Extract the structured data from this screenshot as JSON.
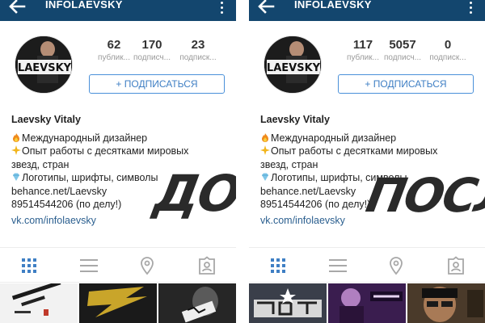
{
  "colors": {
    "header_bg": "#13466e",
    "accent": "#3f7fc4",
    "link": "#2b5f8f"
  },
  "panels": [
    {
      "header": {
        "back_icon": "arrow-left-icon",
        "title": "INFOLAEVSKY",
        "more_icon": "more-vertical-icon"
      },
      "avatar": {
        "logo_text": "LAEVSKY"
      },
      "stats": [
        {
          "value": "62",
          "label": "публик..."
        },
        {
          "value": "170",
          "label": "подписч..."
        },
        {
          "value": "23",
          "label": "подписк..."
        }
      ],
      "follow_button": "+ ПОДПИСАТЬСЯ",
      "bio": {
        "name": "Laevsky Vitaly",
        "line1": "Международный дизайнер",
        "line2": "Опыт работы с десятками мировых",
        "line3": "звезд, стран",
        "line4": "Логотипы, шрифты, символы",
        "line5": "behance.net/Laevsky",
        "line6": "89514544206 (по делу!)",
        "link": "vk.com/infolaevsky"
      },
      "stamp": "ДО",
      "tabs": [
        "grid-icon",
        "list-icon",
        "location-pin-icon",
        "tagged-person-icon"
      ]
    },
    {
      "header": {
        "back_icon": "arrow-left-icon",
        "title": "INFOLAEVSKY",
        "more_icon": "more-vertical-icon"
      },
      "avatar": {
        "logo_text": "LAEVSKY"
      },
      "stats": [
        {
          "value": "117",
          "label": "публик..."
        },
        {
          "value": "5057",
          "label": "подписч..."
        },
        {
          "value": "0",
          "label": "подписк..."
        }
      ],
      "follow_button": "+ ПОДПИСАТЬСЯ",
      "bio": {
        "name": "Laevsky Vitaly",
        "line1": "Международный дизайнер",
        "line2": "Опыт работы с десятками мировых",
        "line3": "звезд, стран",
        "line4": "Логотипы, шрифты, символы",
        "line5": "behance.net/Laevsky",
        "line6": "89514544206 (по делу!)",
        "link": "vk.com/infolaevsky"
      },
      "stamp": "ПОСЛЕ",
      "tabs": [
        "grid-icon",
        "list-icon",
        "location-pin-icon",
        "tagged-person-icon"
      ]
    }
  ]
}
